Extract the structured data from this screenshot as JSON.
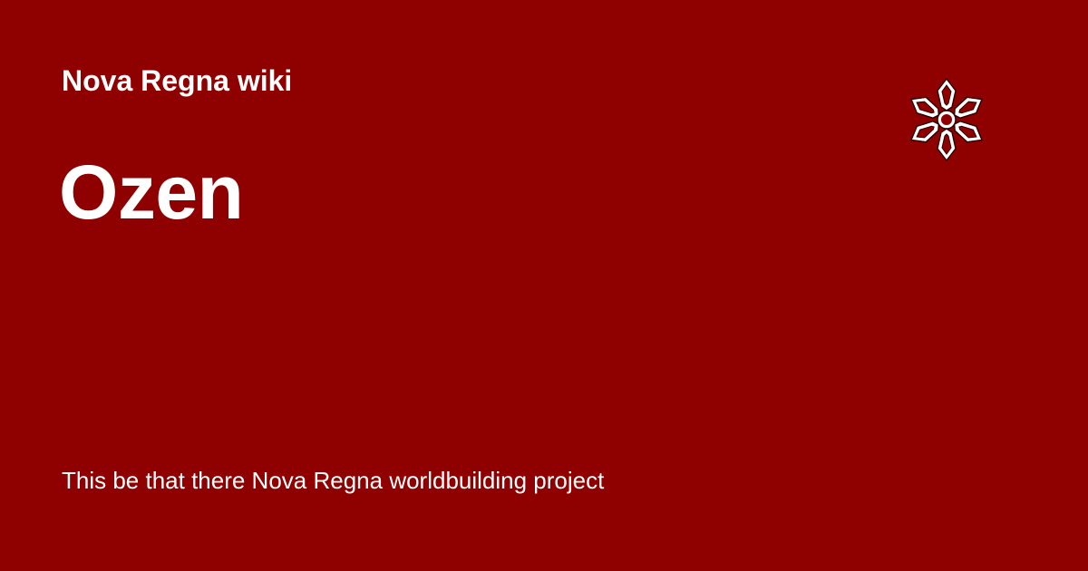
{
  "site": {
    "name": "Nova Regna wiki",
    "logo_icon": "emblem-icon"
  },
  "page": {
    "title": "Ozen",
    "description": "This be that there Nova Regna worldbuilding project"
  },
  "theme": {
    "background": "#8f0000",
    "text": "#ffffff"
  }
}
